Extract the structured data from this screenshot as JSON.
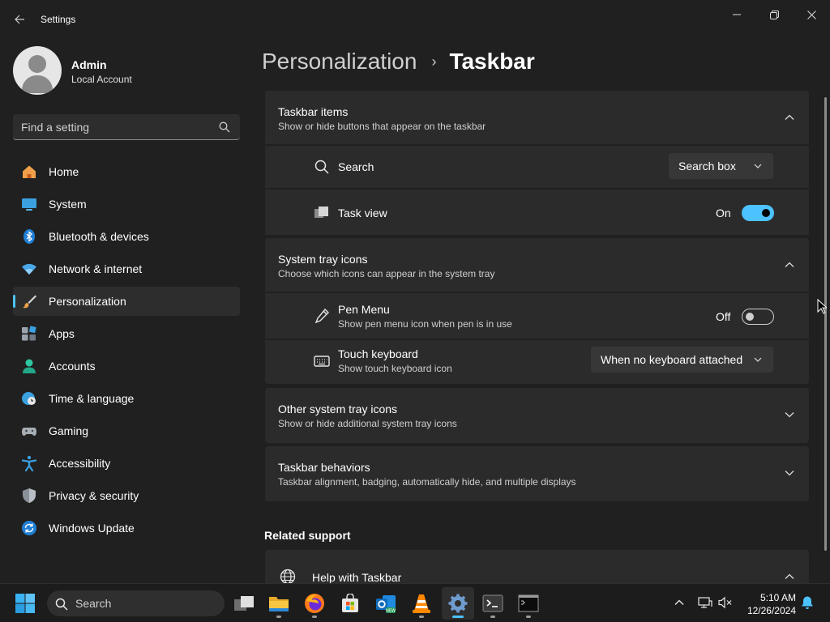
{
  "window": {
    "title": "Settings"
  },
  "profile": {
    "name": "Admin",
    "account_type": "Local Account"
  },
  "search": {
    "placeholder": "Find a setting"
  },
  "sidebar": {
    "items": [
      {
        "label": "Home",
        "icon": "home-icon"
      },
      {
        "label": "System",
        "icon": "system-icon"
      },
      {
        "label": "Bluetooth & devices",
        "icon": "bluetooth-icon"
      },
      {
        "label": "Network & internet",
        "icon": "wifi-icon"
      },
      {
        "label": "Personalization",
        "icon": "brush-icon",
        "active": true
      },
      {
        "label": "Apps",
        "icon": "apps-icon"
      },
      {
        "label": "Accounts",
        "icon": "accounts-icon"
      },
      {
        "label": "Time & language",
        "icon": "globe-clock-icon"
      },
      {
        "label": "Gaming",
        "icon": "gamepad-icon"
      },
      {
        "label": "Accessibility",
        "icon": "accessibility-icon"
      },
      {
        "label": "Privacy & security",
        "icon": "shield-icon"
      },
      {
        "label": "Windows Update",
        "icon": "update-icon"
      }
    ]
  },
  "breadcrumb": {
    "parent": "Personalization",
    "separator": "›",
    "current": "Taskbar"
  },
  "sections": {
    "taskbar_items": {
      "title": "Taskbar items",
      "subtitle": "Show or hide buttons that appear on the taskbar",
      "expanded": true,
      "rows": {
        "search": {
          "label": "Search",
          "icon": "search-icon",
          "value": "Search box"
        },
        "task_view": {
          "label": "Task view",
          "icon": "task-view-icon",
          "state_label": "On",
          "on": true
        }
      }
    },
    "system_tray": {
      "title": "System tray icons",
      "subtitle": "Choose which icons can appear in the system tray",
      "expanded": true,
      "rows": {
        "pen_menu": {
          "label": "Pen Menu",
          "subtitle": "Show pen menu icon when pen is in use",
          "icon": "pen-icon",
          "state_label": "Off",
          "on": false
        },
        "touch_keyboard": {
          "label": "Touch keyboard",
          "subtitle": "Show touch keyboard icon",
          "icon": "keyboard-icon",
          "value": "When no keyboard attached"
        }
      }
    },
    "other_tray": {
      "title": "Other system tray icons",
      "subtitle": "Show or hide additional system tray icons",
      "expanded": false
    },
    "behaviors": {
      "title": "Taskbar behaviors",
      "subtitle": "Taskbar alignment, badging, automatically hide, and multiple displays",
      "expanded": false
    }
  },
  "related_support": {
    "heading": "Related support",
    "help": {
      "label": "Help with Taskbar",
      "icon": "globe-icon",
      "expanded": true
    }
  },
  "taskbar": {
    "search_label": "Search",
    "apps": [
      {
        "name": "Task View",
        "icon": "task-view-icon"
      },
      {
        "name": "File Explorer",
        "icon": "folder-icon"
      },
      {
        "name": "Firefox",
        "icon": "firefox-icon"
      },
      {
        "name": "Microsoft Store",
        "icon": "store-icon"
      },
      {
        "name": "Outlook (new)",
        "icon": "outlook-icon"
      },
      {
        "name": "VLC",
        "icon": "vlc-icon"
      },
      {
        "name": "Settings",
        "icon": "gear-icon",
        "active": true
      },
      {
        "name": "Terminal",
        "icon": "terminal-icon"
      },
      {
        "name": "Command Prompt",
        "icon": "cmd-icon"
      }
    ],
    "tray": {
      "time": "5:10 AM",
      "date": "12/26/2024"
    }
  },
  "colors": {
    "accent": "#4cc2ff",
    "background": "#202020",
    "card": "#2b2b2b"
  }
}
